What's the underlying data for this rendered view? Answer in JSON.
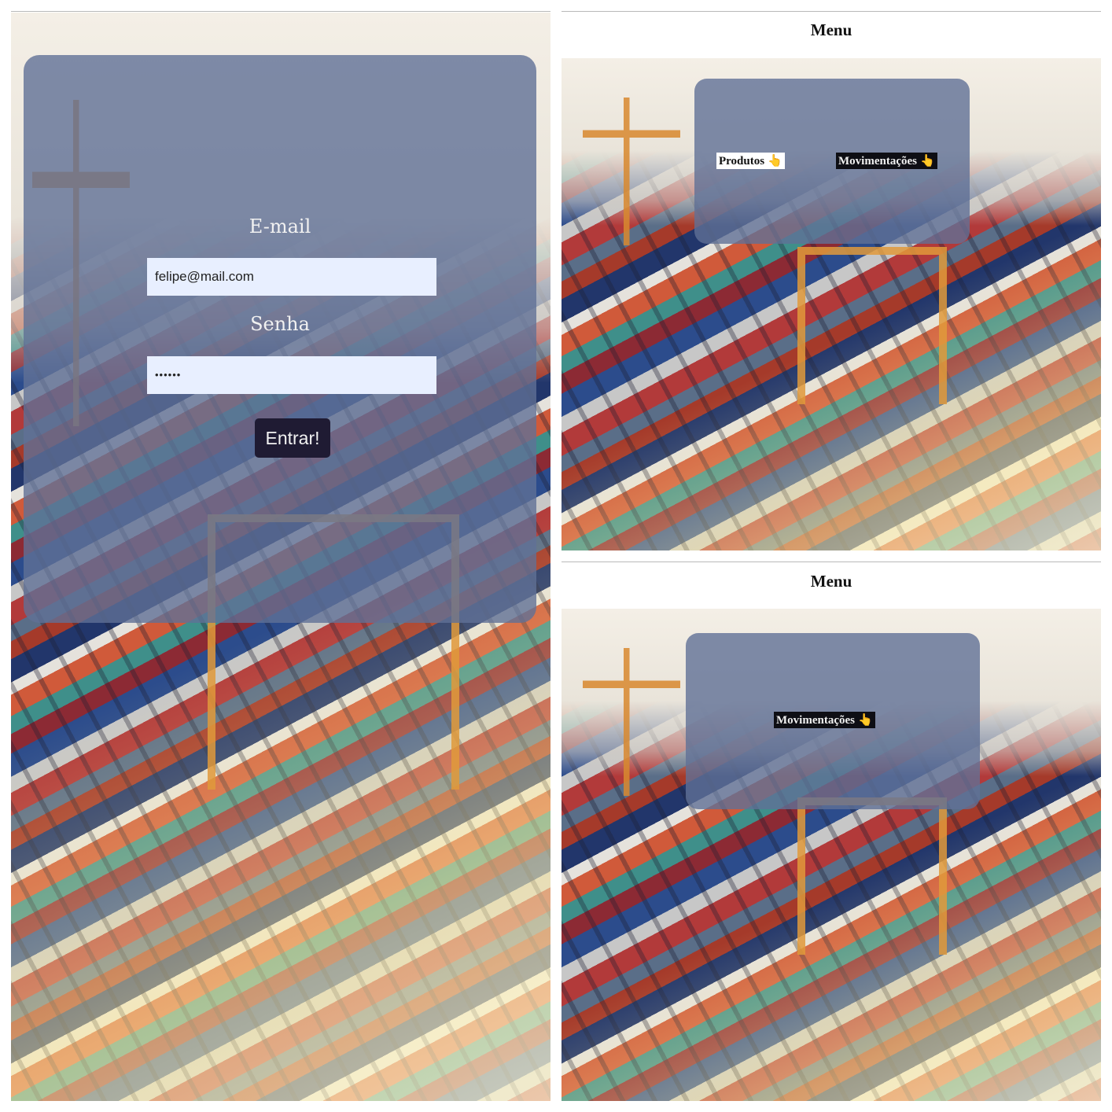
{
  "login": {
    "email_label": "E-mail",
    "email_value": "felipe@mail.com",
    "password_label": "Senha",
    "password_value": "••••••",
    "submit_label": "Entrar!"
  },
  "menu_screen_1": {
    "title": "Menu",
    "links": [
      {
        "label": "Produtos",
        "icon": "pointing-hand-icon"
      },
      {
        "label": "Movimentações",
        "icon": "pointing-hand-icon"
      }
    ]
  },
  "menu_screen_2": {
    "title": "Menu",
    "links": [
      {
        "label": "Movimentações",
        "icon": "pointing-hand-icon"
      }
    ]
  },
  "icons": {
    "pointer_glyph": "👆"
  }
}
